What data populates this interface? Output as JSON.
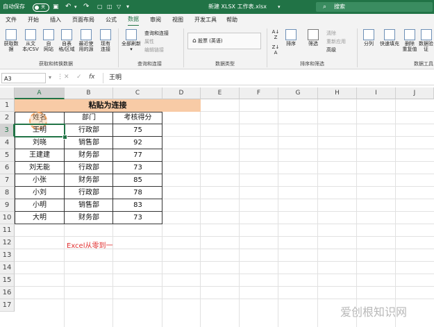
{
  "titlebar": {
    "autosave_label": "自动保存",
    "autosave_state": "关",
    "filename": "新建 XLSX 工作表.xlsx",
    "search_placeholder": "搜索"
  },
  "menu_tabs": [
    "文件",
    "开始",
    "插入",
    "页面布局",
    "公式",
    "数据",
    "审阅",
    "视图",
    "开发工具",
    "帮助"
  ],
  "active_tab": "数据",
  "ribbon": {
    "get_data": {
      "btn1": "获取数",
      "btn1b": "据",
      "btn2": "从文",
      "btn2b": "本/CSV",
      "btn3": "自",
      "btn3b": "网站",
      "btn4": "自表",
      "btn4b": "格/区域",
      "btn5": "最近使",
      "btn5b": "用的源",
      "btn6": "现有",
      "btn6b": "连接",
      "group": "获取和转换数据"
    },
    "queries": {
      "refresh": "全部刷新",
      "q1": "查询和连接",
      "q2": "属性",
      "q3": "编辑链接",
      "group": "查询和连接"
    },
    "datatypes": {
      "stock": "股票 (英语)",
      "group": "数据类型"
    },
    "sort_filter": {
      "sort": "排序",
      "filter": "筛选",
      "clear": "清除",
      "reapply": "重新应用",
      "advanced": "高级",
      "group": "排序和筛选"
    },
    "tools": {
      "split": "分列",
      "flash": "快速填充",
      "dup": "删除",
      "dup_b": "重复值",
      "valid": "数据验",
      "valid_b": "证",
      "group": "数据工具"
    }
  },
  "formula_bar": {
    "namebox": "A3",
    "fx": "fx",
    "value": "王明"
  },
  "columns": [
    "A",
    "B",
    "C",
    "D",
    "E",
    "F",
    "G",
    "H",
    "I",
    "J"
  ],
  "rows": [
    "1",
    "2",
    "3",
    "4",
    "5",
    "6",
    "7",
    "8",
    "9",
    "10",
    "11",
    "12",
    "13",
    "14",
    "15",
    "16",
    "17"
  ],
  "sheet": {
    "title": "粘贴为连接",
    "headers": [
      "姓名",
      "部门",
      "考核得分"
    ],
    "records": [
      [
        "王明",
        "行政部",
        "75"
      ],
      [
        "刘晓",
        "销售部",
        "92"
      ],
      [
        "王建建",
        "财务部",
        "77"
      ],
      [
        "刘无能",
        "行政部",
        "73"
      ],
      [
        "小张",
        "财务部",
        "85"
      ],
      [
        "小刘",
        "行政部",
        "78"
      ],
      [
        "小明",
        "销售部",
        "83"
      ],
      [
        "大明",
        "财务部",
        "73"
      ]
    ],
    "note": "Excel从零到一"
  },
  "watermark": "爱创根知识网",
  "colors": {
    "excel_green": "#217346",
    "title_fill": "#f8cba6",
    "note_red": "#e03030"
  }
}
